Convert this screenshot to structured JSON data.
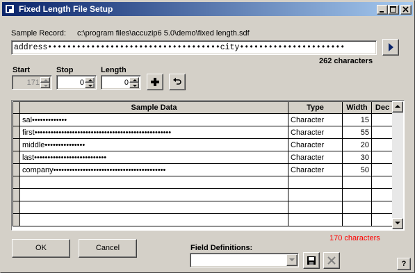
{
  "window": {
    "title": "Fixed Length File Setup"
  },
  "sample": {
    "label": "Sample Record:",
    "path": "c:\\program files\\accuzip6 5.0\\demo\\fixed length.sdf",
    "record": "address••••••••••••••••••••••••••••••••••••city••••••••••••••••••••••",
    "char_count": "262 characters"
  },
  "fields": {
    "start_label": "Start",
    "start_value": "171",
    "stop_label": "Stop",
    "stop_value": "0",
    "length_label": "Length",
    "length_value": "0"
  },
  "grid": {
    "headers": [
      "Sample Data",
      "Type",
      "Width",
      "Dec"
    ],
    "rows": [
      {
        "sample": "sal•••••••••••••",
        "type": "Character",
        "width": "15",
        "dec": ""
      },
      {
        "sample": "first•••••••••••••••••••••••••••••••••••••••••••••••••••",
        "type": "Character",
        "width": "55",
        "dec": ""
      },
      {
        "sample": "middle•••••••••••••••",
        "type": "Character",
        "width": "20",
        "dec": ""
      },
      {
        "sample": "last•••••••••••••••••••••••••••",
        "type": "Character",
        "width": "30",
        "dec": ""
      },
      {
        "sample": "company••••••••••••••••••••••••••••••••••••••••••",
        "type": "Character",
        "width": "50",
        "dec": ""
      }
    ],
    "total": "170 characters"
  },
  "buttons": {
    "ok": "OK",
    "cancel": "Cancel",
    "help": "?"
  },
  "field_definitions": {
    "label": "Field Definitions:",
    "value": ""
  },
  "colors": {
    "title_start": "#0a246a",
    "title_end": "#a6caf0",
    "total_text": "#ff0000",
    "face": "#d4d0c8"
  }
}
